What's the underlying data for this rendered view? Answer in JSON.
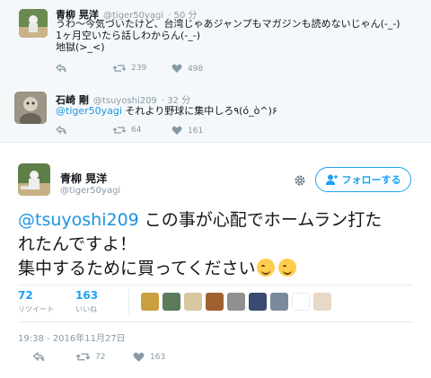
{
  "tweets": [
    {
      "name": "青柳 晃洋",
      "handle": "@tiger50yagi",
      "time": "· 50 分",
      "lines": [
        "うわ～今気づいたけど、台湾じゃあジャンプもマガジンも読めないじゃん(-_-)",
        "1ヶ月空いたら話しわからん(-_-)",
        "地獄(>_<)"
      ],
      "retweets": "239",
      "likes": "498"
    },
    {
      "name": "石崎 剛",
      "handle": "@tsuyoshi209",
      "time": "· 32 分",
      "mention": "@tiger50yagi",
      "text": " それより野球に集中しろ٩(ó_ò^)۶",
      "retweets": "64",
      "likes": "161"
    }
  ],
  "main": {
    "name": "青柳 晃洋",
    "handle": "@tiger50yagi",
    "follow_label": "フォローする",
    "mention": "@tsuyoshi209",
    "line1": " この事が心配でホームラン打た",
    "line2": "れたんですよ！",
    "line3": "集中するために買ってください",
    "retweet_count": "72",
    "retweet_label": "リツイート",
    "like_count": "163",
    "like_label": "いいね",
    "timestamp": "19:38 - 2016年11月27日",
    "footer_retweets": "72",
    "footer_likes": "163"
  },
  "colors": {
    "accent": "#1da1f2",
    "muted": "#8899a6",
    "like_pink": "#e0245e"
  }
}
